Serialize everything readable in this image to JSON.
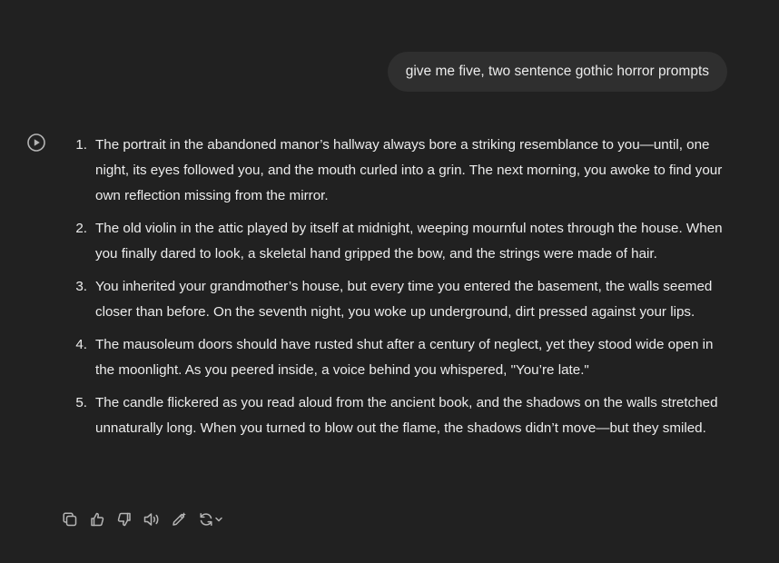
{
  "user_message": {
    "text": "give me five, two sentence gothic horror prompts"
  },
  "assistant": {
    "avatar_icon": "play-circle-icon",
    "items": [
      {
        "number": "1.",
        "text": "The portrait in the abandoned manor’s hallway always bore a striking resemblance to you—until, one night, its eyes followed you, and the mouth curled into a grin. The next morning, you awoke to find your own reflection missing from the mirror."
      },
      {
        "number": "2.",
        "text": "The old violin in the attic played by itself at midnight, weeping mournful notes through the house. When you finally dared to look, a skeletal hand gripped the bow, and the strings were made of hair."
      },
      {
        "number": "3.",
        "text": "You inherited your grandmother’s house, but every time you entered the basement, the walls seemed closer than before. On the seventh night, you woke up underground, dirt pressed against your lips."
      },
      {
        "number": "4.",
        "text": "The mausoleum doors should have rusted shut after a century of neglect, yet they stood wide open in the moonlight. As you peered inside, a voice behind you whispered, \"You’re late.\""
      },
      {
        "number": "5.",
        "text": "The candle flickered as you read aloud from the ancient book, and the shadows on the walls stretched unnaturally long. When you turned to blow out the flame, the shadows didn’t move—but they smiled."
      }
    ]
  },
  "toolbar": {
    "icons": [
      "copy-icon",
      "thumbs-up-icon",
      "thumbs-down-icon",
      "read-aloud-icon",
      "edit-icon",
      "regenerate-icon",
      "chevron-down-icon"
    ]
  },
  "colors": {
    "background": "#212121",
    "user_bubble": "#2f2f2f",
    "text": "#ececec",
    "icon": "#b4b4b4"
  }
}
